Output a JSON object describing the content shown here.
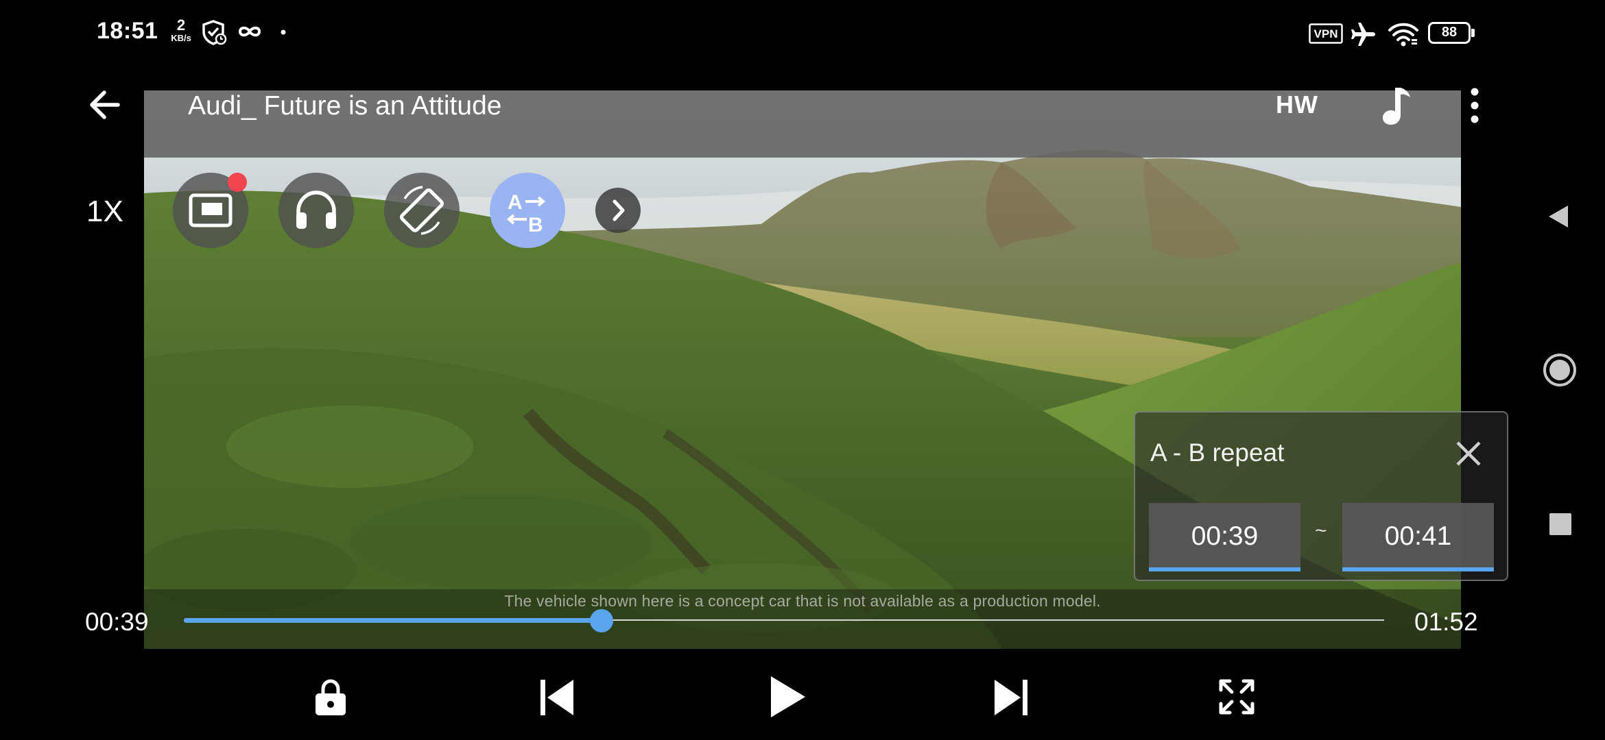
{
  "status_bar": {
    "time": "18:51",
    "net_rate_value": "2",
    "net_rate_unit": "KB/s",
    "vpn_label": "VPN",
    "battery": "88",
    "icons": [
      "shield-check-icon",
      "infinity-icon",
      "dot-icon",
      "vpn-icon",
      "airplane-icon",
      "wifi-icon",
      "battery-icon"
    ]
  },
  "player": {
    "title": "Audi_ Future is an Attitude",
    "decoder": "HW",
    "speed": "1X",
    "subtitle": "The vehicle shown here is a concept car that is not available as a production model.",
    "current_time": "00:39",
    "duration": "01:52",
    "progress": 0.348,
    "quick_actions": [
      {
        "name": "popup-play-icon",
        "active": false,
        "badge": true
      },
      {
        "name": "background-play-icon",
        "active": false
      },
      {
        "name": "rotate-screen-icon",
        "active": false
      },
      {
        "name": "ab-repeat-icon",
        "active": true
      }
    ],
    "accent_color": "#5aa5ee"
  },
  "ab_repeat": {
    "title": "A - B repeat",
    "a_time": "00:39",
    "separator": "~",
    "b_time": "00:41"
  },
  "controls": [
    "lock-icon",
    "skip-previous-icon",
    "play-icon",
    "skip-next-icon",
    "fullscreen-icon"
  ],
  "nav_bar": [
    "back-triangle-icon",
    "home-circle-icon",
    "recents-square-icon"
  ]
}
